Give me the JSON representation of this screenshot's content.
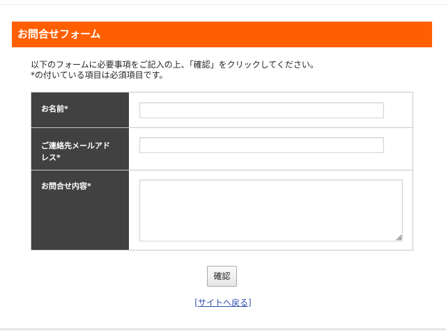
{
  "header": {
    "title": "お問合せフォーム",
    "bar_color": "#ff5f00"
  },
  "intro": {
    "line1": "以下のフォームに必要事項をご記入の上、「確認」をクリックしてください。",
    "line2": "*の付いている項目は必須項目です。"
  },
  "form": {
    "fields": [
      {
        "label": "お名前*",
        "value": "",
        "type": "text"
      },
      {
        "label_line1": "ご連絡先メールアド",
        "label_line2": "レス*",
        "value": "",
        "type": "email"
      },
      {
        "label": "お問合せ内容*",
        "value": "",
        "type": "textarea"
      }
    ],
    "label_bg": "#414141"
  },
  "actions": {
    "confirm_label": "確認",
    "back_bracket_open": "[",
    "back_label": "サイトへ戻る",
    "back_bracket_close": "]"
  }
}
